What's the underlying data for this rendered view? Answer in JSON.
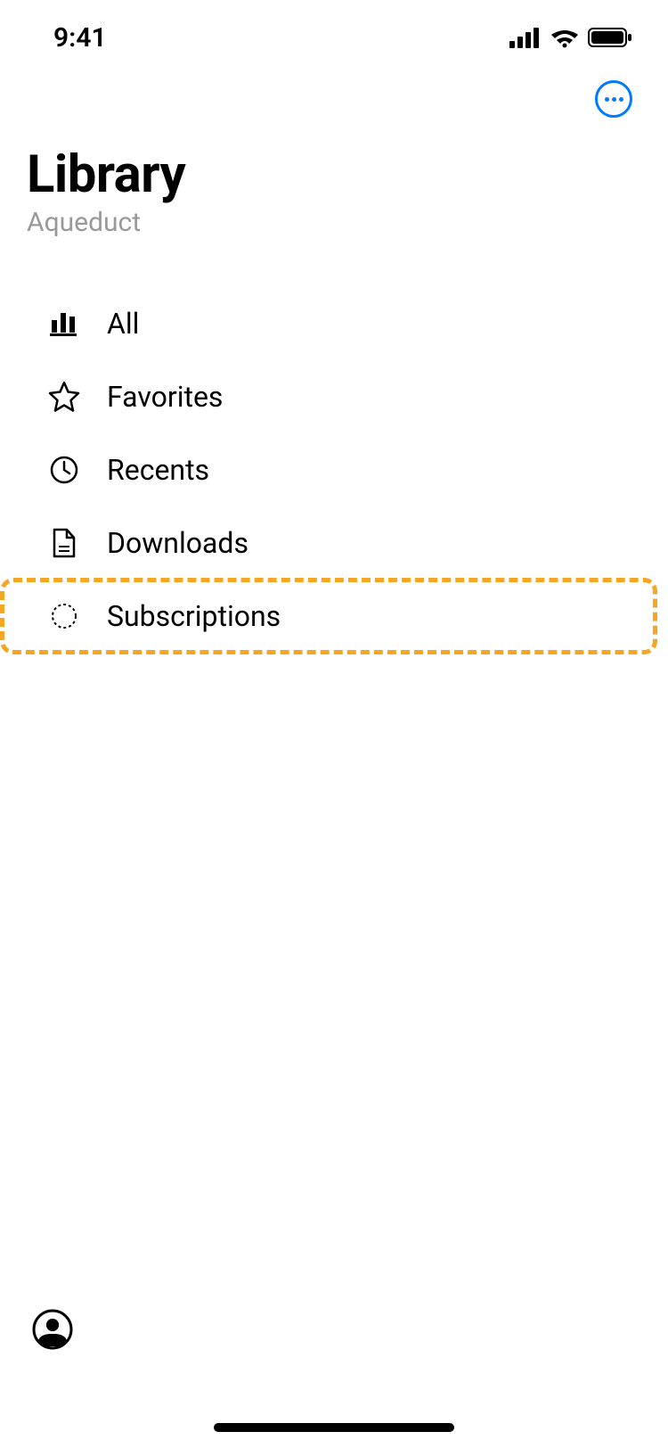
{
  "status_bar": {
    "time": "9:41"
  },
  "header": {
    "title": "Library",
    "subtitle": "Aqueduct"
  },
  "menu": {
    "items": [
      {
        "icon": "chart-bars",
        "label": "All"
      },
      {
        "icon": "star",
        "label": "Favorites"
      },
      {
        "icon": "clock",
        "label": "Recents"
      },
      {
        "icon": "document",
        "label": "Downloads"
      },
      {
        "icon": "dotted-circle",
        "label": "Subscriptions"
      }
    ]
  }
}
